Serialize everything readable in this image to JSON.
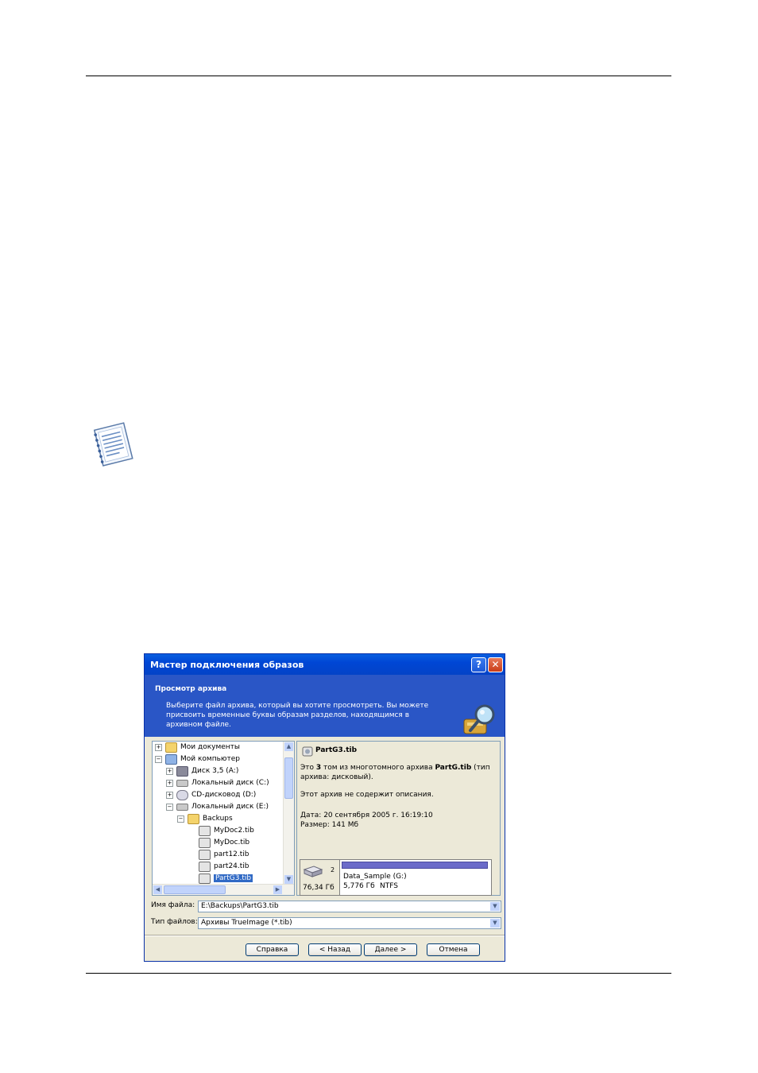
{
  "dialog": {
    "title": "Мастер подключения образов",
    "help_label": "?",
    "close_label": "✕",
    "banner": {
      "title": "Просмотр архива",
      "description": "Выберите файл архива, который вы хотите просмотреть. Вы можете присвоить временные буквы образам разделов, находящимся в архивном файле."
    },
    "tree": [
      {
        "label": "Мои документы",
        "expander": "+",
        "icon": "folder-icon"
      },
      {
        "label": "Мой компьютер",
        "expander": "−",
        "icon": "computer-icon"
      },
      {
        "label": "Диск 3,5 (A:)",
        "expander": "+",
        "icon": "floppy-icon"
      },
      {
        "label": "Локальный диск (C:)",
        "expander": "+",
        "icon": "drive-icon"
      },
      {
        "label": "CD-дисковод (D:)",
        "expander": "+",
        "icon": "cdrom-icon"
      },
      {
        "label": "Локальный диск (E:)",
        "expander": "−",
        "icon": "drive-icon"
      },
      {
        "label": "Backups",
        "expander": "−",
        "icon": "open-folder-icon"
      },
      {
        "label": "MyDoc2.tib",
        "icon": "archive-icon"
      },
      {
        "label": "MyDoc.tib",
        "icon": "archive-icon"
      },
      {
        "label": "part12.tib",
        "icon": "archive-icon"
      },
      {
        "label": "part24.tib",
        "icon": "archive-icon"
      },
      {
        "label": "PartG3.tib",
        "icon": "archive-icon",
        "selected": true
      }
    ],
    "info": {
      "file_name": "PartG3.tib",
      "desc_prefix": "Это ",
      "desc_volume": "3",
      "desc_middle": " том из многотомного архива ",
      "desc_archive": "PartG.tib",
      "desc_suffix": " (тип архива: дисковый).",
      "no_description": "Этот архив не содержит описания.",
      "date": "Дата: 20 сентября 2005 г. 16:19:10",
      "size": "Размер: 141 Мб",
      "disk": {
        "number": "2",
        "capacity": "76,34 Гб",
        "partition_name": "Data_Sample (G:)",
        "partition_size": "5,776 Гб",
        "partition_fs": "NTFS"
      }
    },
    "file_name_label": "Имя файла:",
    "file_name_value": "E:\\Backups\\PartG3.tib",
    "file_type_label": "Тип файлов:",
    "file_type_value": "Архивы TrueImage (*.tib)",
    "buttons": {
      "help": "Справка",
      "back": "< Назад",
      "next": "Далее >",
      "cancel": "Отмена"
    }
  },
  "colors": {
    "title_bar": "#0046d5",
    "banner": "#2a56c6",
    "dialog_bg": "#ece9d8",
    "selection": "#316ac5"
  }
}
